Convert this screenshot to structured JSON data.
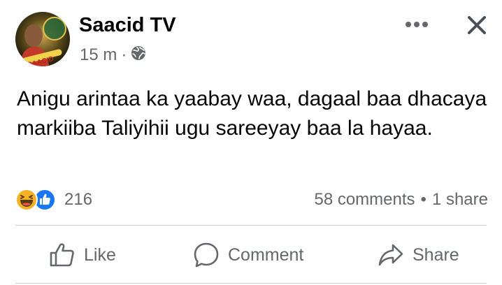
{
  "post": {
    "author": "Saacid TV",
    "avatar_caption": "SAACID",
    "time": "15 m",
    "separator": "·",
    "privacy_icon": "globe-icon",
    "text": "Anigu arintaa ka yaabay waa, dagaal baa dhacaya markiiba Taliyihii ugu sareeyay baa la hayaa."
  },
  "header_actions": {
    "more_icon": "more-horizontal-icon",
    "close_icon": "close-icon"
  },
  "engagement": {
    "reactions": [
      "haha-emoji",
      "like-emoji"
    ],
    "reaction_count": "216",
    "comments": "58 comments",
    "stats_separator": "•",
    "shares": "1 share"
  },
  "actions": {
    "like": "Like",
    "comment": "Comment",
    "share": "Share"
  },
  "colors": {
    "secondary_text": "#65676b",
    "like_blue": "#1877f2",
    "haha_yellow": "#f7b125",
    "divider": "#ced0d4"
  }
}
